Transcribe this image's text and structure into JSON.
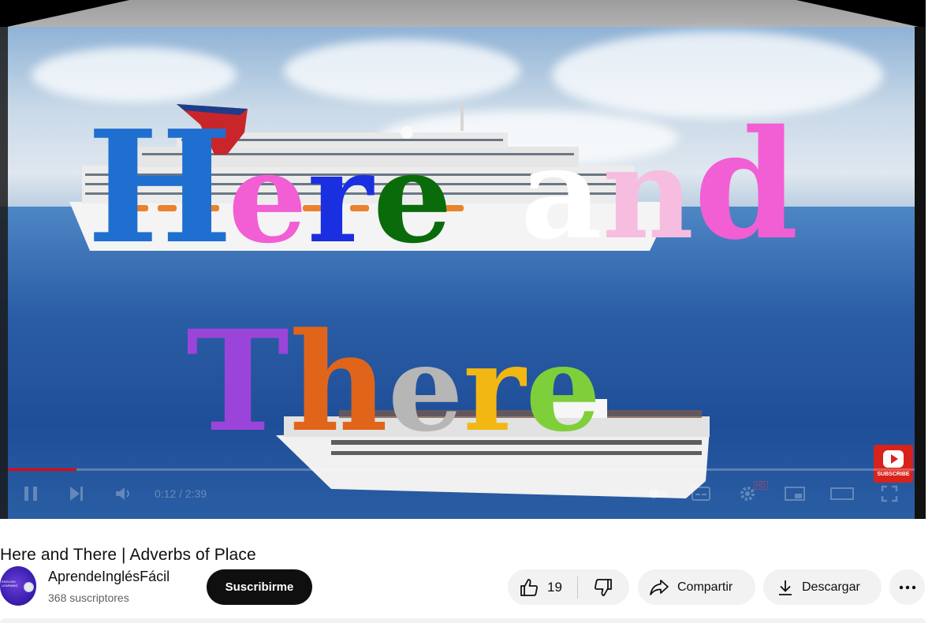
{
  "player": {
    "overlay_line1": [
      "H",
      "e",
      "r",
      "e",
      "a",
      "n",
      "d"
    ],
    "overlay_line1_colors": [
      "#1f6fd1",
      "#f25ed4",
      "#1a2fe0",
      "#0a6b0a",
      "#ffffff",
      "#f7bde0",
      "#f25ed4"
    ],
    "overlay_line2": [
      "T",
      "h",
      "e",
      "r",
      "e"
    ],
    "overlay_line2_colors": [
      "#9b44d9",
      "#e0651a",
      "#b6b6b6",
      "#f2b712",
      "#7fcf3a"
    ],
    "progress_fraction": 0.076,
    "time_display": "0:12 / 2:39",
    "subscribe_badge_text": "SUBSCRIBE",
    "hd_badge": "HD",
    "controls": {
      "play_icon": "pause-icon",
      "next_icon": "next-icon",
      "volume_icon": "volume-icon"
    }
  },
  "video": {
    "title": "Here and There | Adverbs of Place"
  },
  "channel": {
    "name": "AprendeInglésFácil",
    "subscribers": "368 suscriptores",
    "avatar_text": "ENGLISH LEARNING",
    "subscribe_label": "Suscribirme"
  },
  "actions": {
    "like_count": "19",
    "share_label": "Compartir",
    "download_label": "Descargar"
  }
}
